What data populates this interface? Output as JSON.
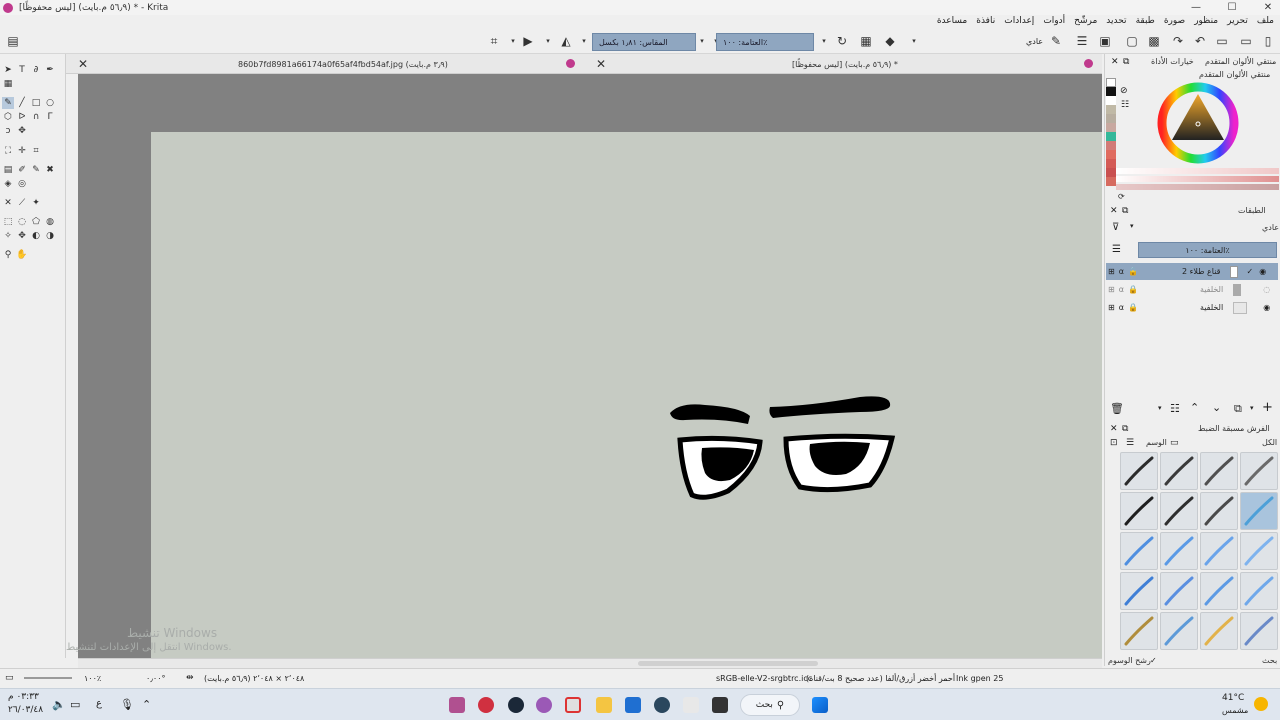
{
  "window": {
    "title": "[ليس محفوظًا] (٥٦٫٩ م.بايت) * - Krita"
  },
  "menu": [
    "ملف",
    "تحرير",
    "منظور",
    "صورة",
    "طبقة",
    "تحديد",
    "مرشّح",
    "أدوات",
    "إعدادات",
    "نافذة",
    "مساعدة"
  ],
  "toolbar": {
    "blend_mode": "عادي",
    "opacity_label": "العتامة: ١٠٠٪",
    "size_label": "المقاس: ١٫٨١ بكسل"
  },
  "documents": {
    "tab1_title": "860b7fd8981a66174a0f65af4fbd54af.jpg (٣٫٩ م.بايت)",
    "tab2_title": "[ليس محفوظًا] (٥٦٫٩ م.بايت) *"
  },
  "watermark": {
    "line1": "تنشيط Windows",
    "line2": "انتقل إلى الإعدادات لتنشيط Windows."
  },
  "dockers": {
    "color_tab1": "منتقي الألوان المتقدم",
    "color_tab2": "خيارات الأداة",
    "color_title": "منتقي الألوان المتقدم",
    "layers_title": "الطبقات",
    "layers_blend": "عادي",
    "layers_opacity": "العتامة: ١٠٠٪",
    "layers": [
      {
        "name": "قناع طلاء 2",
        "selected": true
      },
      {
        "name": "الخلفية",
        "selected": false
      },
      {
        "name": "الخلفية",
        "selected": false
      }
    ],
    "brush_title": "الفرش مسبقة الضبط",
    "brush_filter": "الكل",
    "brush_tag": "الوسم",
    "brush_search": "بحث",
    "brush_tag_filter": "رشح الوسوم"
  },
  "status": {
    "brush": "Ink gpen 25",
    "colorspace": "أحمر أخضر أزرق/ألفا (عدد صحيح 8 بت/قناة)",
    "profile": "sRGB-elle-V2-srgbtrc.icc",
    "dimensions": "٢٬٠٤٨ × ٢٬٠٤٨ (٥٦٫٩ م.بايت)",
    "rotation": "٠٫٠٠°",
    "zoom": "١٠٠٪"
  },
  "taskbar": {
    "weather_temp": "41°C",
    "weather_desc": "مشمس",
    "search": "بحث",
    "time": "٠٣:٣٣ م",
    "date": "٢٦/٠٣/٤٨",
    "lang": "ع"
  },
  "brush_colors": [
    "#2b2b2b",
    "#3a3a3a",
    "#505050",
    "#6a6a6a",
    "#1f1f1f",
    "#2e2e2e",
    "#4a4a4a",
    "#4da0d8",
    "#4f8fe0",
    "#5a9ae6",
    "#6aa4ea",
    "#7eb3ee",
    "#3f7fd6",
    "#5a8fe0",
    "#5c9ae4",
    "#6fa8ea",
    "#b08d3c",
    "#5d9ad8",
    "#e2b24a",
    "#6a8ac8"
  ]
}
